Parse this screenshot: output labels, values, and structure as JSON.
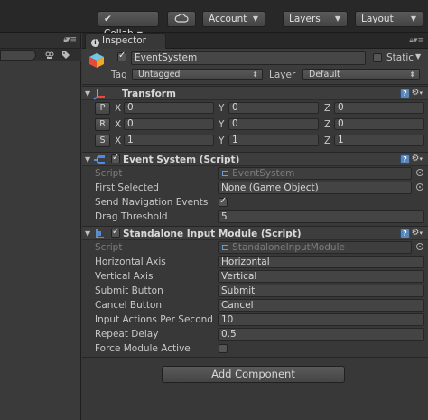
{
  "toolbar": {
    "collab": "Collab",
    "account": "Account",
    "layers": "Layers",
    "layout": "Layout"
  },
  "inspector": {
    "tab_label": "Inspector"
  },
  "game_object": {
    "active": true,
    "name": "EventSystem",
    "static_label": "Static",
    "static": false,
    "tag_label": "Tag",
    "tag_value": "Untagged",
    "layer_label": "Layer",
    "layer_value": "Default"
  },
  "transform": {
    "title": "Transform",
    "rows": [
      {
        "button": "P",
        "x": "0",
        "y": "0",
        "z": "0"
      },
      {
        "button": "R",
        "x": "0",
        "y": "0",
        "z": "0"
      },
      {
        "button": "S",
        "x": "1",
        "y": "1",
        "z": "1"
      }
    ],
    "axis_x": "X",
    "axis_y": "Y",
    "axis_z": "Z"
  },
  "event_system": {
    "title": "Event System (Script)",
    "enabled": true,
    "script_label": "Script",
    "script_value": "EventSystem",
    "first_selected_label": "First Selected",
    "first_selected_value": "None (Game Object)",
    "send_nav_label": "Send Navigation Events",
    "send_nav_value": true,
    "drag_threshold_label": "Drag Threshold",
    "drag_threshold_value": "5"
  },
  "standalone_input": {
    "title": "Standalone Input Module (Script)",
    "enabled": true,
    "script_label": "Script",
    "script_value": "StandaloneInputModule",
    "horizontal_axis_label": "Horizontal Axis",
    "horizontal_axis_value": "Horizontal",
    "vertical_axis_label": "Vertical Axis",
    "vertical_axis_value": "Vertical",
    "submit_label": "Submit Button",
    "submit_value": "Submit",
    "cancel_label": "Cancel Button",
    "cancel_value": "Cancel",
    "input_actions_label": "Input Actions Per Second",
    "input_actions_value": "10",
    "repeat_delay_label": "Repeat Delay",
    "repeat_delay_value": "0.5",
    "force_active_label": "Force Module Active",
    "force_active_value": false
  },
  "add_component_label": "Add Component",
  "colors": {
    "background": "#383838",
    "toolbar": "#282828",
    "help_icon": "#5a87b8",
    "cube_top": "#6fc8e8",
    "cube_left": "#e84a3a",
    "cube_right": "#f0a828"
  }
}
